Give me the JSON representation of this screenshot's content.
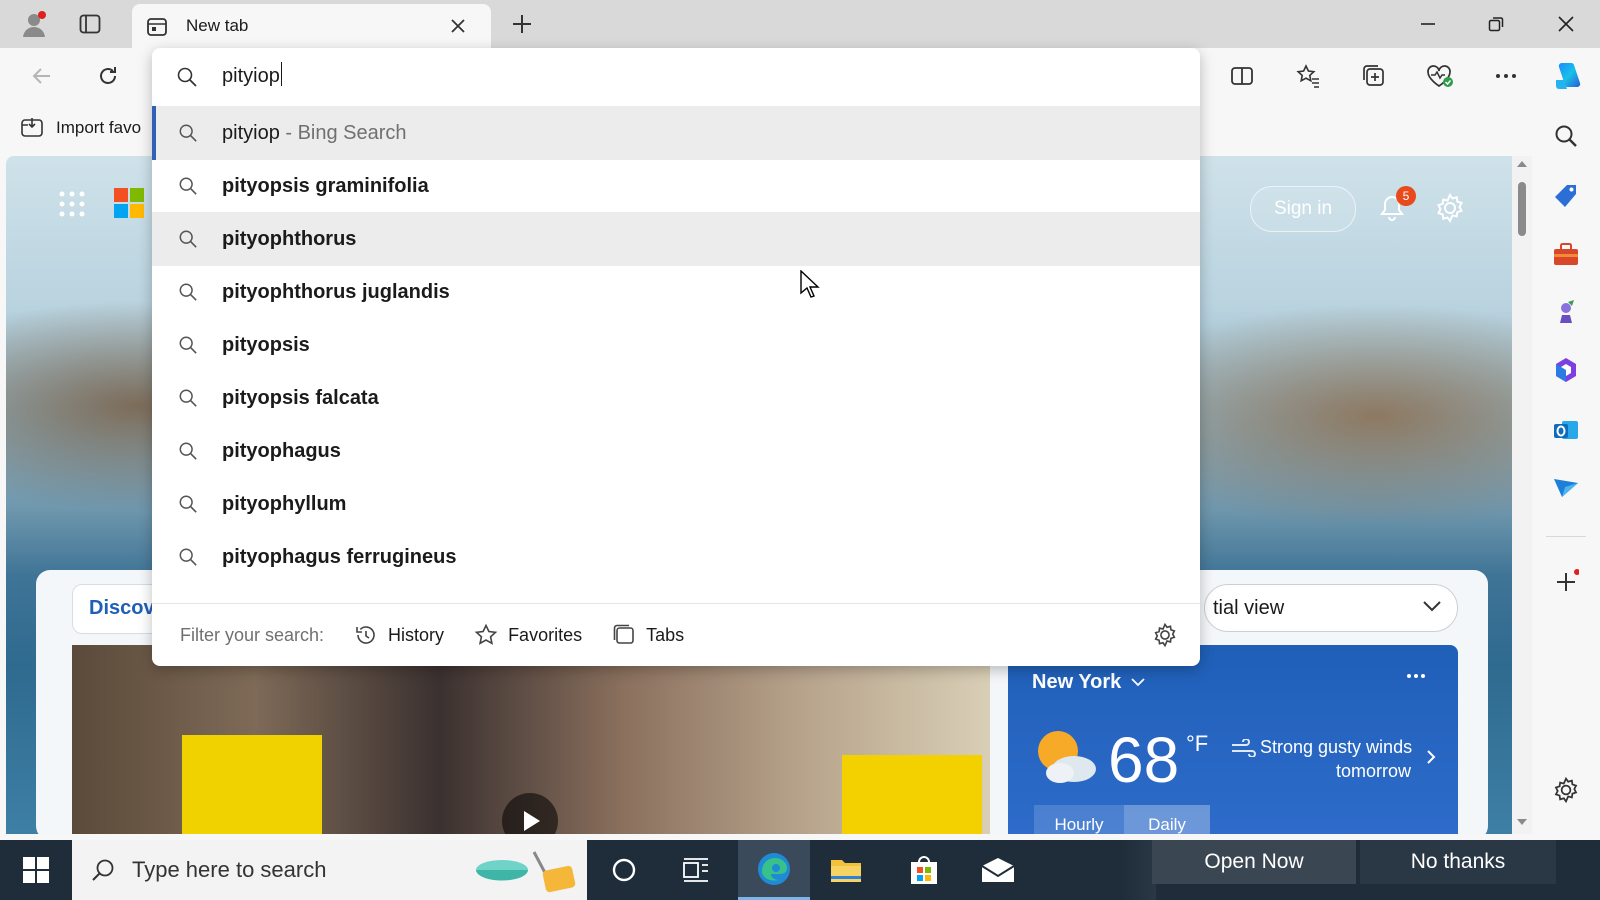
{
  "browser": {
    "tab_title": "New tab",
    "favorites_bar": {
      "import_label": "Import favo"
    }
  },
  "address_bar": {
    "value": "pityiop"
  },
  "suggestions": {
    "items": [
      {
        "text": "pityiop",
        "sub": " - Bing Search"
      },
      {
        "text": "pityopsis graminifolia"
      },
      {
        "text": "pityophthorus"
      },
      {
        "text": "pityophthorus juglandis"
      },
      {
        "text": "pityopsis"
      },
      {
        "text": "pityopsis falcata"
      },
      {
        "text": "pityophagus"
      },
      {
        "text": "pityophyllum"
      },
      {
        "text": "pityophagus ferrugineus"
      }
    ],
    "filter_label": "Filter your search:",
    "filters": [
      "History",
      "Favorites",
      "Tabs"
    ]
  },
  "newtab": {
    "sign_in": "Sign in",
    "notification_count": "5",
    "discover_tab": "Discov",
    "layout_select": "tial view",
    "weather": {
      "city": "New York",
      "temperature": "68",
      "unit": "°F",
      "alert_line1": "Strong gusty winds",
      "alert_line2": "tomorrow",
      "tabs": [
        "Hourly",
        "Daily"
      ]
    }
  },
  "taskbar": {
    "search_placeholder": "Type here to search",
    "open_now": "Open Now",
    "no_thanks": "No thanks"
  },
  "colors": {
    "accent": "#3060b8",
    "taskbar": "#1f2d3a",
    "weather": "#2f6ccb"
  }
}
